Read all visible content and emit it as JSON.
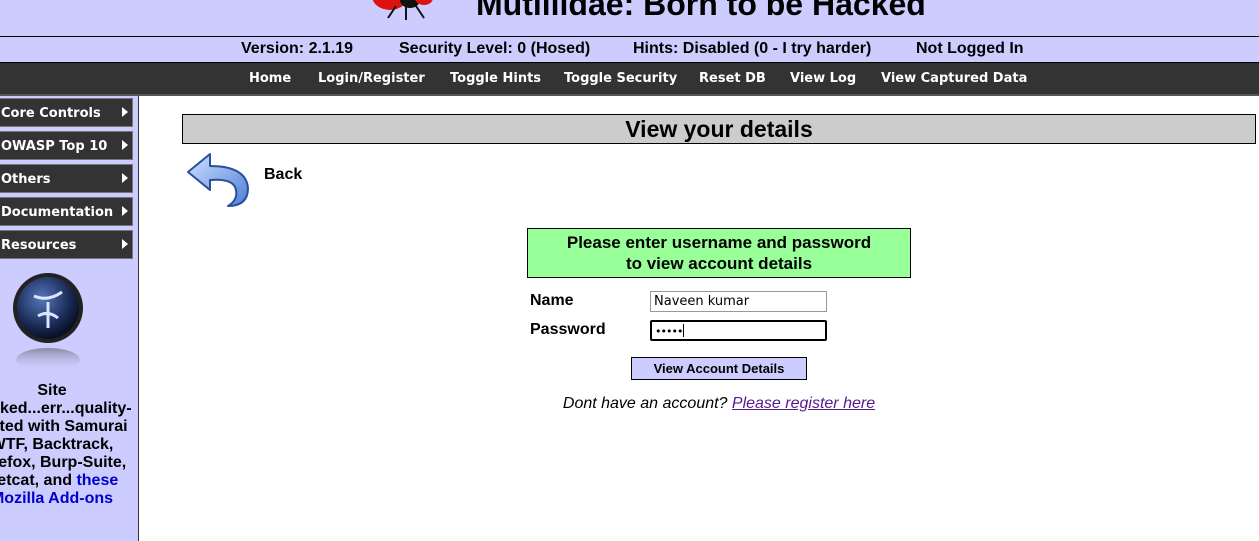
{
  "header": {
    "title": "Mutillidae: Born to be Hacked"
  },
  "status_bar": {
    "version": "Version: 2.1.19",
    "security_level": "Security Level: 0 (Hosed)",
    "hints": "Hints: Disabled (0 - I try harder)",
    "login_status": "Not Logged In"
  },
  "nav": {
    "items": [
      {
        "label": "Home"
      },
      {
        "label": "Login/Register"
      },
      {
        "label": "Toggle Hints"
      },
      {
        "label": "Toggle Security"
      },
      {
        "label": "Reset DB"
      },
      {
        "label": "View Log"
      },
      {
        "label": "View Captured Data"
      }
    ]
  },
  "sidebar": {
    "items": [
      {
        "label": "Core Controls"
      },
      {
        "label": "OWASP Top 10"
      },
      {
        "label": "Others"
      },
      {
        "label": "Documentation"
      },
      {
        "label": "Resources"
      }
    ],
    "logo_icon": "owasp-wasp-logo",
    "blurb_lines": [
      "Site",
      "hacked...err...quality-",
      "tested with Samurai",
      "WTF, Backtrack,",
      "Firefox, Burp-Suite,",
      "Netcat, and"
    ],
    "blurb_link_1": "these",
    "blurb_link_2": "Mozilla Add-ons"
  },
  "main": {
    "heading": "View your details",
    "back_label": "Back",
    "back_icon": "back-arrow-icon",
    "login_prompt_line1": "Please enter username and password",
    "login_prompt_line2": "to view account details",
    "name_label": "Name",
    "name_value": "Naveen kumar",
    "password_label": "Password",
    "password_value": "•••••",
    "submit_label": "View Account Details",
    "register_prompt": "Dont have an account?",
    "register_link": "Please register here"
  },
  "colors": {
    "header_bg": "#ccccff",
    "nav_bg": "#333333",
    "heading_bg": "#cccccc",
    "prompt_bg": "#99ff99",
    "link_visited": "#551a8b"
  }
}
